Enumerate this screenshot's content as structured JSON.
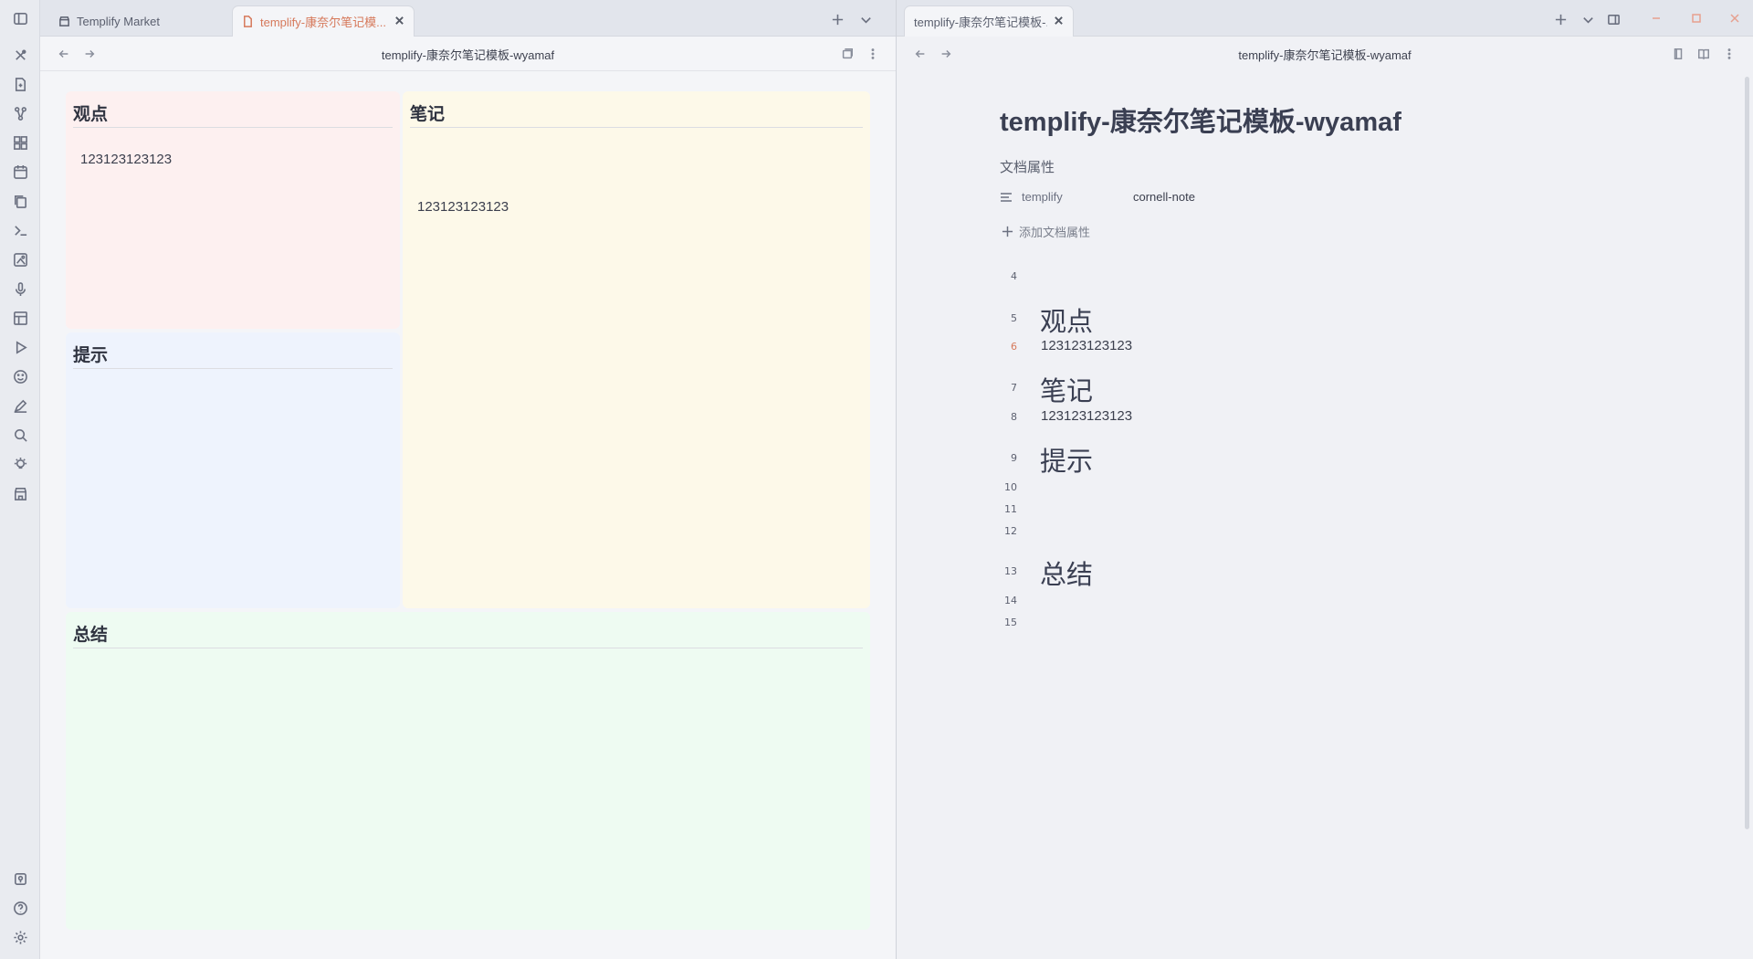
{
  "ribbon": {
    "top_icons": [
      "close-x-icon",
      "file-plus-icon",
      "graph-icon",
      "grid-icon",
      "calendar-icon",
      "copy-icon",
      "terminal-icon",
      "image-icon",
      "mic-icon",
      "layout-icon",
      "play-icon",
      "smiley-icon",
      "pen-icon",
      "search-icon",
      "bulb-icon",
      "store-icon"
    ],
    "bottom_icons": [
      "vault-icon",
      "help-icon",
      "settings-icon"
    ]
  },
  "left": {
    "tabs": [
      {
        "label": "Templify Market",
        "icon": "store-icon"
      },
      {
        "label": "templify-康奈尔笔记模...",
        "icon": "file-icon"
      }
    ],
    "title": "templify-康奈尔笔记模板-wyamaf",
    "cards": {
      "viewpoint": {
        "heading": "观点",
        "text": "123123123123"
      },
      "notes": {
        "heading": "笔记",
        "text": "123123123123"
      },
      "tips": {
        "heading": "提示",
        "text": ""
      },
      "summary": {
        "heading": "总结",
        "text": ""
      }
    }
  },
  "right": {
    "tab": {
      "label": "templify-康奈尔笔记模板-..."
    },
    "title": "templify-康奈尔笔记模板-wyamaf",
    "doc": {
      "title": "templify-康奈尔笔记模板-wyamaf",
      "properties_heading": "文档属性",
      "property": {
        "key": "templify",
        "value": "cornell-note"
      },
      "add_property": "添加文档属性",
      "lines": {
        "n4": "4",
        "n5": "5",
        "n6": "6",
        "n7": "7",
        "n8": "8",
        "n9": "9",
        "n10": "10",
        "n11": "11",
        "n12": "12",
        "n13": "13",
        "n14": "14",
        "n15": "15"
      },
      "h_viewpoint": "观点",
      "t_viewpoint": "123123123123",
      "h_notes": "笔记",
      "t_notes": "123123123123",
      "h_tips": "提示",
      "h_summary": "总结"
    }
  },
  "colors": {
    "accent": "#d6795b",
    "viewpoint_bg": "#fdf0f0",
    "notes_bg": "#fdf9e9",
    "tips_bg": "#eef3fd",
    "summary_bg": "#eefbf2"
  }
}
